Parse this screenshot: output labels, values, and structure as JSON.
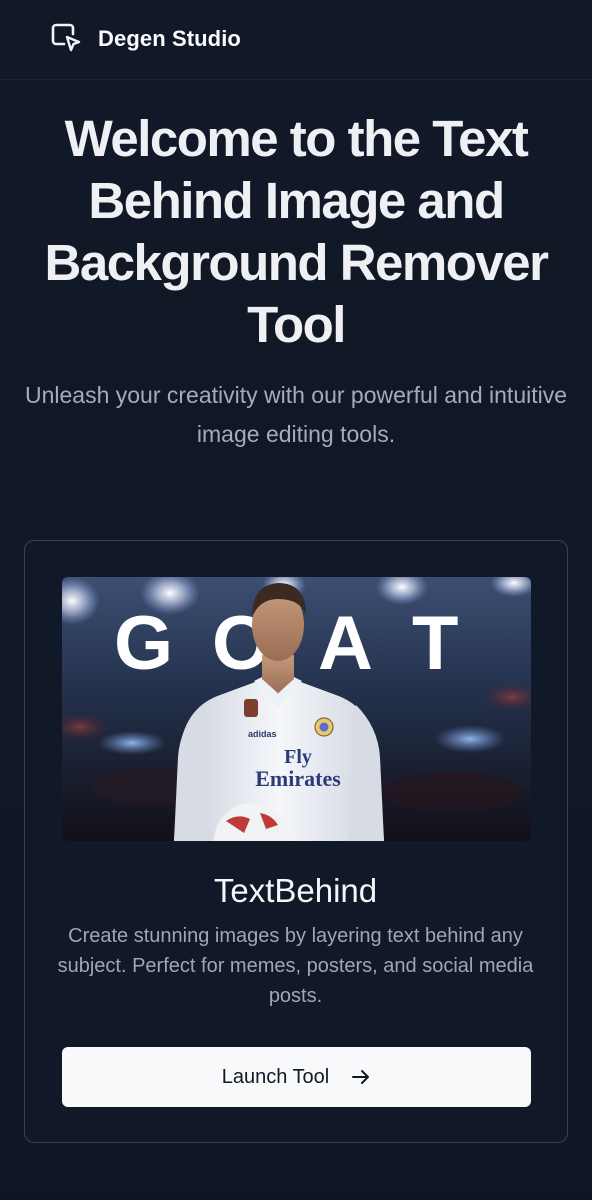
{
  "header": {
    "brand_name": "Degen Studio",
    "logo_icon": "selection-cursor-icon"
  },
  "hero": {
    "title": "Welcome to the Text Behind Image and Background Remover Tool",
    "subtitle": "Unleash your creativity with our powerful and intuitive image editing tools."
  },
  "card": {
    "image": {
      "overlay_text": "G O A T",
      "jersey_sponsor_line1": "Fly",
      "jersey_sponsor_line2": "Emirates",
      "jersey_brand": "adidas"
    },
    "title": "TextBehind",
    "description": "Create stunning images by layering text behind any subject. Perfect for memes, posters, and social media posts.",
    "button_label": "Launch Tool",
    "button_icon": "arrow-right-icon"
  },
  "colors": {
    "background": "#0f1625",
    "header_background": "#111827",
    "card_border": "#3a4252",
    "button_background": "#f8f9fb",
    "title_text": "#eef0f3",
    "muted_text": "#a3acbb"
  }
}
